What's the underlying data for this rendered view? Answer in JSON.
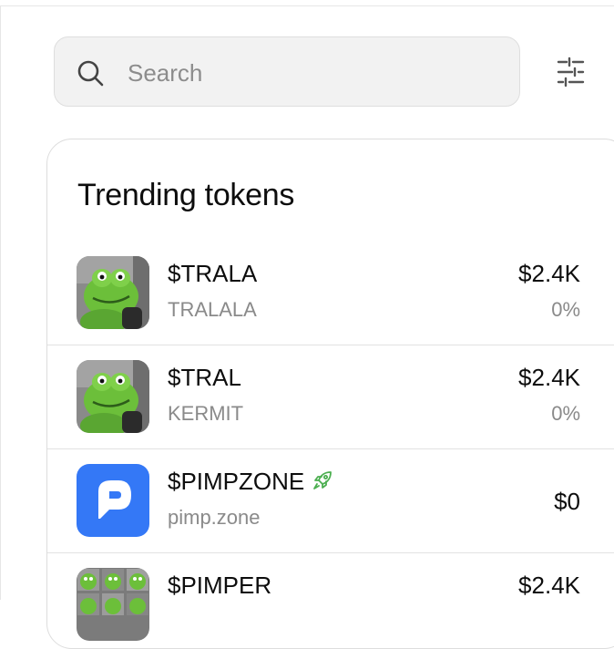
{
  "search": {
    "placeholder": "Search",
    "value": ""
  },
  "trending": {
    "title": "Trending tokens",
    "tokens": [
      {
        "symbol": "$TRALA",
        "name": "TRALALA",
        "price": "$2.4K",
        "change": "0%",
        "icon": "kermit-avatar"
      },
      {
        "symbol": "$TRAL",
        "name": "KERMIT",
        "price": "$2.4K",
        "change": "0%",
        "icon": "kermit-avatar"
      },
      {
        "symbol": "$PIMPZONE",
        "name": "pimp.zone",
        "price": "$0",
        "change": "",
        "icon": "pimp-zone-logo",
        "badge": "rocket-icon",
        "badge_color": "#4caf50"
      },
      {
        "symbol": "$PIMPER",
        "name": "",
        "price": "$2.4K",
        "change": "",
        "icon": "kermit-collage"
      }
    ]
  },
  "colors": {
    "pimp_brand": "#3478f6",
    "kermit_green": "#6cbf3a",
    "muted_text": "#8a8a8a"
  }
}
